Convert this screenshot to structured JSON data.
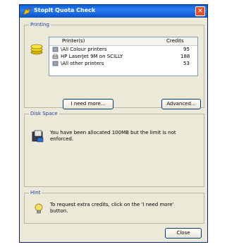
{
  "window": {
    "title": "Stoplt Quota Check",
    "close_glyph": "✕"
  },
  "printing": {
    "group_label": "Printing",
    "columns": [
      "Printer(s)",
      "Credits"
    ],
    "rows": [
      {
        "name": "\\All Colour printers",
        "credits": "95"
      },
      {
        "name": "HP LaserJet 9M on SCILLY",
        "credits": "188"
      },
      {
        "name": "\\All other printers",
        "credits": "53"
      }
    ],
    "need_more_label": "I need more...",
    "advanced_label": "Advanced..."
  },
  "disk_space": {
    "group_label": "Disk Space",
    "message": "You have been allocated 100MB but the limit is not enforced."
  },
  "hint": {
    "group_label": "Hint",
    "message": "To request extra credits, click on the 'I need more' button."
  },
  "footer": {
    "close_label": "Close"
  },
  "colors": {
    "title_bar": "#1e63d8",
    "group_title": "#1a3ea8",
    "dialog_bg": "#ece9d8"
  }
}
